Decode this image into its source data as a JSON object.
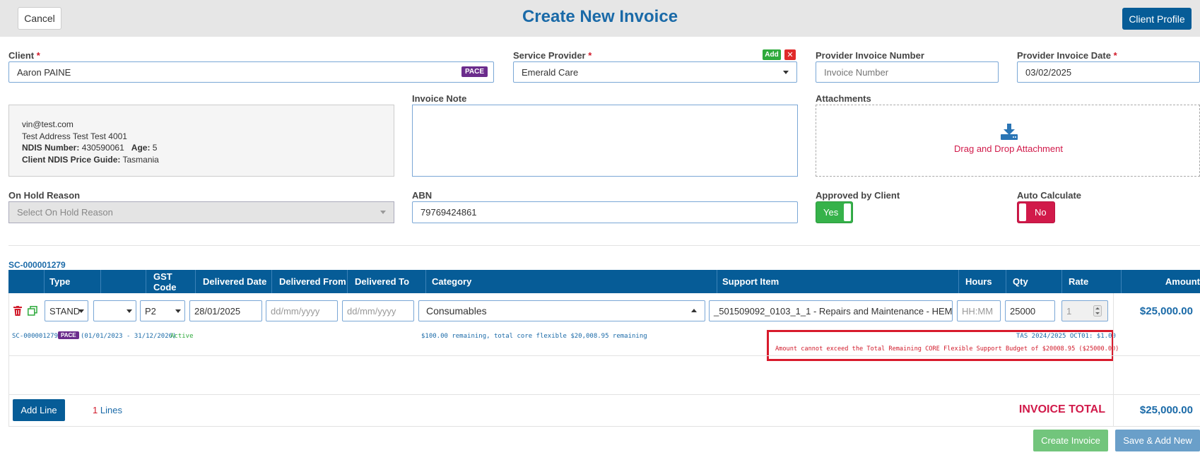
{
  "header": {
    "cancel_label": "Cancel",
    "title": "Create New Invoice",
    "profile_label": "Client Profile"
  },
  "client": {
    "label": "Client",
    "required_mark": "*",
    "value": "Aaron PAINE",
    "badge": "PACE"
  },
  "service_provider": {
    "label": "Service Provider",
    "required_mark": "*",
    "value": "Emerald Care",
    "add_label": "Add",
    "remove_label": "✕"
  },
  "provider_invoice_number": {
    "label": "Provider Invoice Number",
    "placeholder": "Invoice Number"
  },
  "provider_invoice_date": {
    "label": "Provider Invoice Date",
    "required_mark": "*",
    "value": "03/02/2025"
  },
  "client_info": {
    "email": "vin@test.com",
    "address": "Test Address Test Test 4001",
    "ndis_label": "NDIS Number:",
    "ndis_value": "430590061",
    "age_label": "Age:",
    "age_value": "5",
    "price_guide_label": "Client NDIS Price Guide:",
    "price_guide_value": "Tasmania"
  },
  "invoice_note": {
    "label": "Invoice Note",
    "value": ""
  },
  "attachments": {
    "label": "Attachments",
    "drop_text": "Drag and Drop Attachment"
  },
  "on_hold": {
    "label": "On Hold Reason",
    "placeholder": "Select On Hold Reason"
  },
  "abn": {
    "label": "ABN",
    "value": "79769424861"
  },
  "approved": {
    "label": "Approved by Client",
    "state": "Yes"
  },
  "auto_calc": {
    "label": "Auto Calculate",
    "state": "No"
  },
  "table": {
    "sc_number": "SC-000001279",
    "headers": [
      "Type",
      "GST Code",
      "Delivered Date",
      "Delivered From",
      "Delivered To",
      "Category",
      "Support Item",
      "Hours",
      "Qty",
      "Rate",
      "Amount"
    ],
    "row": {
      "type": "STAND",
      "gst": "P2",
      "delivered_date": "28/01/2025",
      "delivered_from_ph": "dd/mm/yyyy",
      "delivered_to_ph": "dd/mm/yyyy",
      "category": "Consumables",
      "support_item": "_501509092_0103_1_1 - Repairs and Maintenance - HEM",
      "hours_ph": "HH:MM",
      "qty": "25000",
      "rate": "1",
      "amount": "$25,000.00"
    },
    "sub": {
      "sc": "SC-000001279",
      "badge": "PACE",
      "period": "(01/01/2023 - 31/12/2026)",
      "status": "Active",
      "remaining": "$100.00 remaining, total core flexible $20,008.95 remaining",
      "price": "TAS 2024/2025 OCT01: $1.00",
      "error": "Amount cannot exceed the Total Remaining CORE Flexible Support Budget of $20008.95 ($25000.00)"
    }
  },
  "footer": {
    "add_line": "Add Line",
    "lines_count": "1",
    "lines_label": "Lines",
    "total_label": "INVOICE TOTAL",
    "total_value": "$25,000.00",
    "create_label": "Create Invoice",
    "save_new_label": "Save & Add New"
  },
  "colors": {
    "primary": "#065c97",
    "accent": "#d11a4a",
    "success": "#36b24a",
    "pace": "#6b2c8c"
  }
}
